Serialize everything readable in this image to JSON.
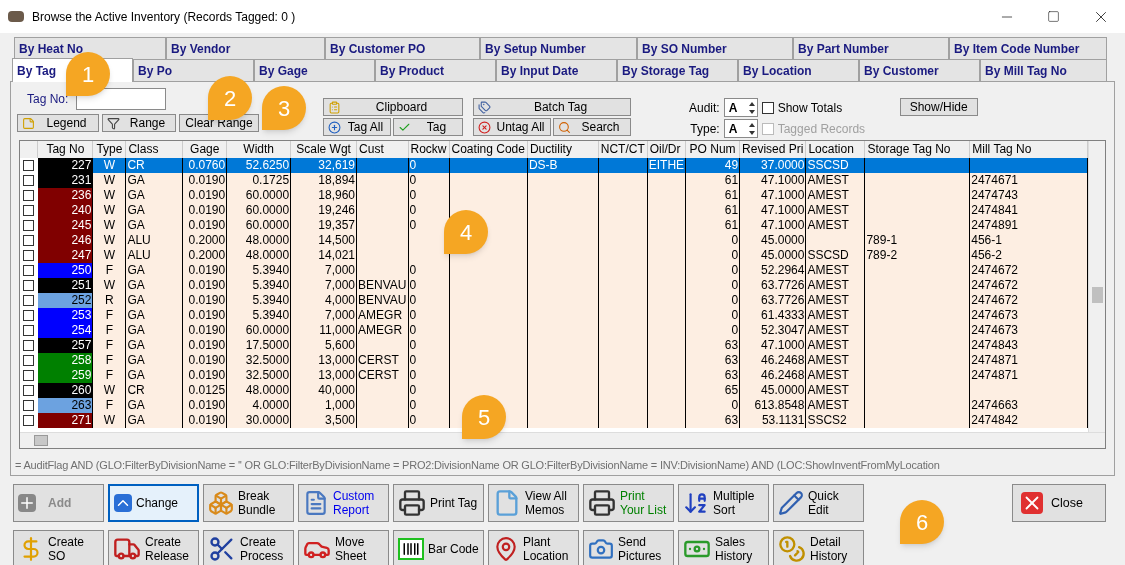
{
  "window": {
    "title": "Browse the Active Inventory  (Records Tagged:  0 )"
  },
  "tabs_row_1": [
    {
      "label": "By Heat No",
      "selected": false
    },
    {
      "label": "By Vendor",
      "selected": false
    },
    {
      "label": "By Customer PO",
      "selected": false
    },
    {
      "label": "By Setup Number",
      "selected": false
    },
    {
      "label": "By SO Number",
      "selected": false
    },
    {
      "label": "By Part Number",
      "selected": false
    },
    {
      "label": "By Item Code Number",
      "selected": false
    }
  ],
  "tabs_row_2": [
    {
      "label": "By Tag",
      "selected": true
    },
    {
      "label": "By Po",
      "selected": false
    },
    {
      "label": "By Gage",
      "selected": false
    },
    {
      "label": "By Product",
      "selected": false
    },
    {
      "label": "By Input Date",
      "selected": false
    },
    {
      "label": "By Storage Tag",
      "selected": false
    },
    {
      "label": "By Location",
      "selected": false
    },
    {
      "label": "By Customer",
      "selected": false
    },
    {
      "label": "By Mill Tag No",
      "selected": false
    }
  ],
  "toolbar": {
    "tag_no_label": "Tag No:",
    "legend": "Legend",
    "range": "Range",
    "clear_range": "Clear Range",
    "clipboard": "Clipboard",
    "tag_all": "Tag All",
    "tag": "Tag",
    "batch_tag": "Batch Tag",
    "untag_all": "Untag All",
    "search": "Search",
    "audit_label": "Audit:",
    "audit_value": "A",
    "type_label": "Type:",
    "type_value": "A",
    "show_totals": {
      "label": "Show Totals",
      "checked": false,
      "disabled": false
    },
    "tagged_records": {
      "label": "Tagged Records",
      "checked": false,
      "disabled": true
    },
    "show_hide": "Show/Hide"
  },
  "table": {
    "columns": [
      "Tag No",
      "Type",
      "Class",
      "Gage",
      "Width",
      "Scale Wgt",
      "Cust",
      "Rockw",
      "Coating Code",
      "Ductility",
      "NCT/CT",
      "Oil/Dr",
      "PO Num",
      "Revised Pri",
      "Location",
      "Storage Tag No",
      "Mill Tag No"
    ],
    "rows": [
      {
        "selected": true,
        "checked": false,
        "color": "#000000",
        "cells": [
          "227",
          "W",
          "CR",
          "0.0760",
          "52.6250",
          "32,619",
          "",
          "0",
          "",
          "DS-B",
          "",
          "EITHE",
          "49",
          "37.0000",
          "SSCSD",
          "",
          ""
        ]
      },
      {
        "selected": false,
        "checked": false,
        "color": "#000000",
        "cells": [
          "231",
          "W",
          "GA",
          "0.0190",
          "0.1725",
          "18,894",
          "",
          "0",
          "",
          "",
          "",
          "",
          "61",
          "47.1000",
          "AMEST",
          "",
          "2474671"
        ]
      },
      {
        "selected": false,
        "checked": false,
        "color": "#800000",
        "cells": [
          "236",
          "W",
          "GA",
          "0.0190",
          "60.0000",
          "18,960",
          "",
          "0",
          "",
          "",
          "",
          "",
          "61",
          "47.1000",
          "AMEST",
          "",
          "2474743"
        ]
      },
      {
        "selected": false,
        "checked": false,
        "color": "#800000",
        "cells": [
          "240",
          "W",
          "GA",
          "0.0190",
          "60.0000",
          "19,246",
          "",
          "0",
          "",
          "",
          "",
          "",
          "61",
          "47.1000",
          "AMEST",
          "",
          "2474841"
        ]
      },
      {
        "selected": false,
        "checked": false,
        "color": "#800000",
        "cells": [
          "245",
          "W",
          "GA",
          "0.0190",
          "60.0000",
          "19,357",
          "",
          "0",
          "",
          "",
          "",
          "",
          "61",
          "47.1000",
          "AMEST",
          "",
          "2474891"
        ]
      },
      {
        "selected": false,
        "checked": false,
        "color": "#800000",
        "cells": [
          "246",
          "W",
          "ALU",
          "0.2000",
          "48.0000",
          "14,500",
          "",
          "",
          "",
          "",
          "",
          "",
          "0",
          "45.0000",
          "",
          "789-1",
          "456-1"
        ]
      },
      {
        "selected": false,
        "checked": false,
        "color": "#800000",
        "cells": [
          "247",
          "W",
          "ALU",
          "0.2000",
          "48.0000",
          "14,021",
          "",
          "",
          "",
          "",
          "",
          "",
          "0",
          "45.0000",
          "SSCSD",
          "789-2",
          "456-2"
        ]
      },
      {
        "selected": false,
        "checked": false,
        "color": "#0000ff",
        "cells": [
          "250",
          "F",
          "GA",
          "0.0190",
          "5.3940",
          "7,000",
          "",
          "0",
          "",
          "",
          "",
          "",
          "0",
          "52.2964",
          "AMEST",
          "",
          "2474672"
        ]
      },
      {
        "selected": false,
        "checked": false,
        "color": "#000000",
        "cells": [
          "251",
          "W",
          "GA",
          "0.0190",
          "5.3940",
          "7,000",
          "BENVAU",
          "0",
          "",
          "",
          "",
          "",
          "0",
          "63.7726",
          "AMEST",
          "",
          "2474672"
        ]
      },
      {
        "selected": false,
        "checked": false,
        "color": "#6ca2e0",
        "cells": [
          "252",
          "R",
          "GA",
          "0.0190",
          "5.3940",
          "4,000",
          "BENVAU",
          "0",
          "",
          "",
          "",
          "",
          "0",
          "63.7726",
          "AMEST",
          "",
          "2474672"
        ]
      },
      {
        "selected": false,
        "checked": false,
        "color": "#0000ff",
        "cells": [
          "253",
          "F",
          "GA",
          "0.0190",
          "5.3940",
          "7,000",
          "AMEGR",
          "0",
          "",
          "",
          "",
          "",
          "0",
          "61.4333",
          "AMEST",
          "",
          "2474673"
        ]
      },
      {
        "selected": false,
        "checked": false,
        "color": "#0000ff",
        "cells": [
          "254",
          "F",
          "GA",
          "0.0190",
          "60.0000",
          "11,000",
          "AMEGR",
          "0",
          "",
          "",
          "",
          "",
          "0",
          "52.3047",
          "AMEST",
          "",
          "2474673"
        ]
      },
      {
        "selected": false,
        "checked": false,
        "color": "#000000",
        "cells": [
          "257",
          "F",
          "GA",
          "0.0190",
          "17.5000",
          "5,600",
          "",
          "0",
          "",
          "",
          "",
          "",
          "63",
          "47.1000",
          "AMEST",
          "",
          "2474843"
        ]
      },
      {
        "selected": false,
        "checked": false,
        "color": "#008000",
        "cells": [
          "258",
          "F",
          "GA",
          "0.0190",
          "32.5000",
          "13,000",
          "CERST",
          "0",
          "",
          "",
          "",
          "",
          "63",
          "46.2468",
          "AMEST",
          "",
          "2474871"
        ]
      },
      {
        "selected": false,
        "checked": false,
        "color": "#008000",
        "cells": [
          "259",
          "F",
          "GA",
          "0.0190",
          "32.5000",
          "13,000",
          "CERST",
          "0",
          "",
          "",
          "",
          "",
          "63",
          "46.2468",
          "AMEST",
          "",
          "2474871"
        ]
      },
      {
        "selected": false,
        "checked": false,
        "color": "#000000",
        "cells": [
          "260",
          "W",
          "CR",
          "0.0125",
          "48.0000",
          "40,000",
          "",
          "0",
          "",
          "",
          "",
          "",
          "65",
          "45.0000",
          "AMEST",
          "",
          ""
        ]
      },
      {
        "selected": false,
        "checked": false,
        "color": "#6ca2e0",
        "cells": [
          "263",
          "F",
          "GA",
          "0.0190",
          "4.0000",
          "1,000",
          "",
          "0",
          "",
          "",
          "",
          "",
          "0",
          "613.8548",
          "AMEST",
          "",
          "2474663"
        ]
      },
      {
        "selected": false,
        "checked": false,
        "color": "#800000",
        "cells": [
          "271",
          "W",
          "GA",
          "0.0190",
          "30.0000",
          "3,500",
          "",
          "0",
          "",
          "",
          "",
          "",
          "63",
          "53.1131",
          "SSCS2",
          "",
          "2474842"
        ]
      }
    ]
  },
  "filter_text": "= AuditFlag AND (GLO:FilterByDivisionName = '' OR GLO:FilterByDivisionName = PRO2:DivisionName OR GLO:FilterByDivisionName = INV:DivisionName) AND (LOC:ShowInventFromMyLocation",
  "buttons_row_1": [
    {
      "label": "Add",
      "disabled": true,
      "focused": false
    },
    {
      "label": "Change",
      "disabled": false,
      "focused": true
    },
    {
      "label": "Break Bundle",
      "disabled": false,
      "focused": false
    },
    {
      "label": "Custom Report",
      "disabled": false,
      "focused": false,
      "color": "#0000ee"
    },
    {
      "label": "Print Tag",
      "disabled": false,
      "focused": false
    },
    {
      "label": "View All Memos",
      "disabled": false,
      "focused": false
    },
    {
      "label": "Print Your List",
      "disabled": false,
      "focused": false,
      "color": "#008000"
    },
    {
      "label": "Multiple Sort",
      "disabled": false,
      "focused": false
    },
    {
      "label": "Quick Edit",
      "disabled": false,
      "focused": false
    }
  ],
  "close_button": "Close",
  "buttons_row_2": [
    {
      "label": "Create SO"
    },
    {
      "label": "Create Release"
    },
    {
      "label": "Create Process"
    },
    {
      "label": "Move Sheet"
    },
    {
      "label": "Bar Code"
    },
    {
      "label": "Plant Location"
    },
    {
      "label": "Send Pictures"
    },
    {
      "label": "Sales History"
    },
    {
      "label": "Detail History"
    }
  ],
  "callouts": [
    "1",
    "2",
    "3",
    "4",
    "5",
    "6"
  ]
}
